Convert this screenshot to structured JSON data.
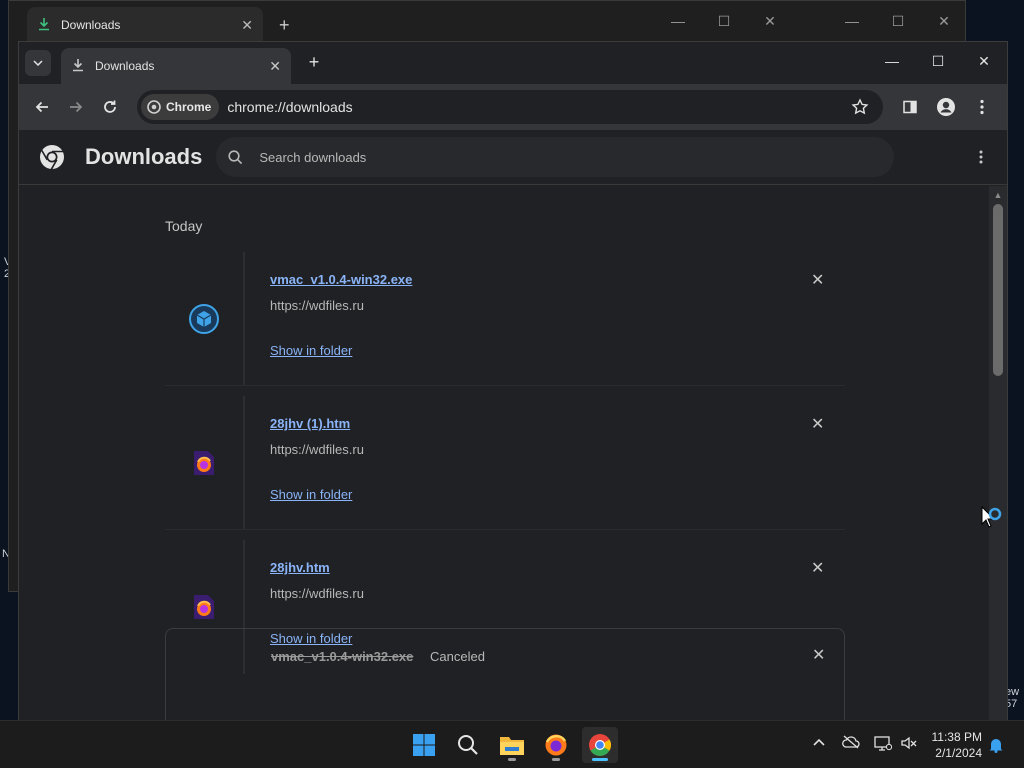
{
  "background_window": {
    "tab_title": "Downloads"
  },
  "window": {
    "tab_title": "Downloads"
  },
  "toolbar": {
    "chip_label": "Chrome",
    "url": "chrome://downloads"
  },
  "page": {
    "title": "Downloads",
    "search_placeholder": "Search downloads",
    "date_group": "Today",
    "downloads": [
      {
        "filename": "vmac_v1.0.4-win32.exe",
        "url": "https://wdfiles.ru",
        "action": "Show in folder",
        "icon": "package-icon"
      },
      {
        "filename": "28jhv (1).htm",
        "url": "https://wdfiles.ru",
        "action": "Show in folder",
        "icon": "firefox-file-icon"
      },
      {
        "filename": "28jhv.htm",
        "url": "https://wdfiles.ru",
        "action": "Show in folder",
        "icon": "firefox-file-icon"
      }
    ],
    "canceled": {
      "filename": "vmac_v1.0.4-win32.exe",
      "status": "Canceled"
    }
  },
  "taskbar": {
    "time": "11:38 PM",
    "date": "2/1/2024"
  },
  "colors": {
    "link": "#8ab4f8",
    "accent": "#4cc2ff",
    "page_bg": "#202124"
  }
}
